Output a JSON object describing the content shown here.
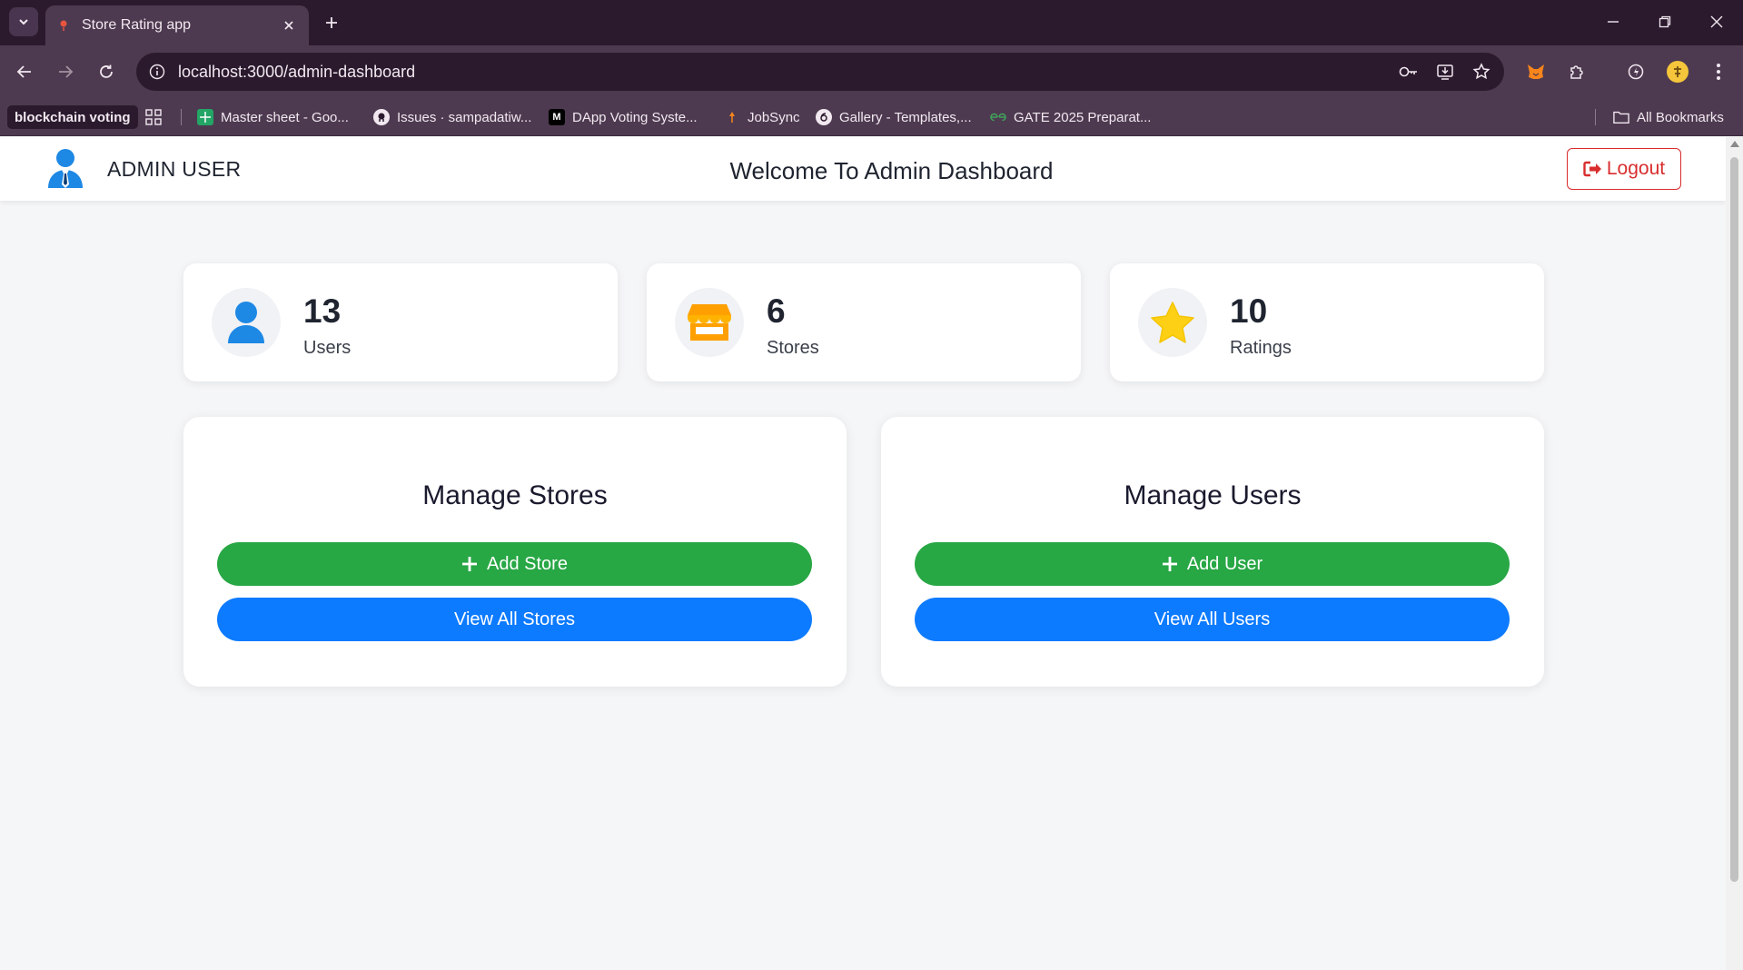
{
  "browser": {
    "tab_title": "Store Rating app",
    "url": "localhost:3000/admin-dashboard",
    "bookmarks": [
      {
        "label": "blockchain voting"
      },
      {
        "label": "Master sheet - Goo..."
      },
      {
        "label": "Issues · sampadatiw..."
      },
      {
        "label": "DApp Voting Syste..."
      },
      {
        "label": "JobSync"
      },
      {
        "label": "Gallery - Templates,..."
      },
      {
        "label": "GATE 2025 Preparat..."
      }
    ],
    "all_bookmarks_label": "All Bookmarks"
  },
  "header": {
    "user_name": "ADMIN USER",
    "title": "Welcome To Admin Dashboard",
    "logout_label": "Logout"
  },
  "stats": [
    {
      "value": "13",
      "label": "Users",
      "icon": "user-icon",
      "color": "#1e88e5"
    },
    {
      "value": "6",
      "label": "Stores",
      "icon": "store-icon",
      "color": "#ffa000"
    },
    {
      "value": "10",
      "label": "Ratings",
      "icon": "star-icon",
      "color": "#fdd015"
    }
  ],
  "manage": {
    "stores": {
      "title": "Manage Stores",
      "add_label": "Add Store",
      "view_label": "View All Stores"
    },
    "users": {
      "title": "Manage Users",
      "add_label": "Add User",
      "view_label": "View All Users"
    }
  },
  "colors": {
    "add_button": "#28a745",
    "view_button": "#0d7bff",
    "logout": "#d92d2d",
    "browser_chrome": "#4e3a50"
  }
}
